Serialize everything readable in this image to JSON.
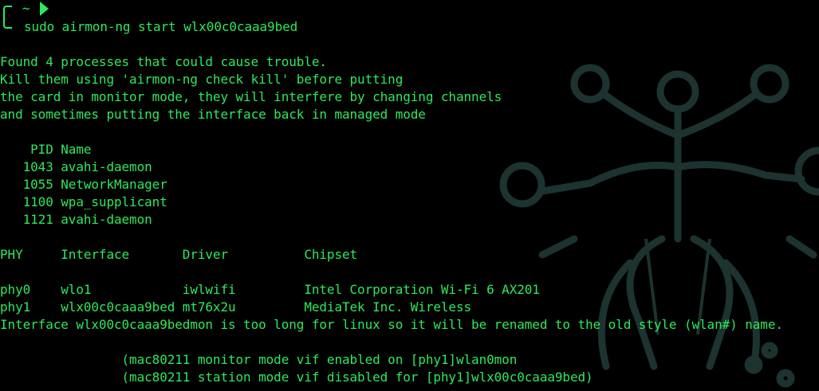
{
  "prompt": {
    "cwd": "~",
    "command": "sudo airmon-ng start wlx00c0caaa9bed"
  },
  "warning": [
    "Found 4 processes that could cause trouble.",
    "Kill them using 'airmon-ng check kill' before putting",
    "the card in monitor mode, they will interfere by changing channels",
    "and sometimes putting the interface back in managed mode"
  ],
  "processes": {
    "header": "    PID Name",
    "rows": [
      "   1043 avahi-daemon",
      "   1055 NetworkManager",
      "   1100 wpa_supplicant",
      "   1121 avahi-daemon"
    ]
  },
  "interfaces": {
    "header": "PHY     Interface       Driver          Chipset",
    "rows": [
      "phy0    wlo1            iwlwifi         Intel Corporation Wi-Fi 6 AX201",
      "phy1    wlx00c0caaa9bed mt76x2u         MediaTek Inc. Wireless"
    ]
  },
  "rename_notice": "Interface wlx00c0caaa9bedmon is too long for linux so it will be renamed to the old style (wlan#) name.",
  "status": [
    "                (mac80211 monitor mode vif enabled on [phy1]wlan0mon",
    "                (mac80211 station mode vif disabled for [phy1]wlx00c0caaa9bed)"
  ],
  "colors": {
    "background": "#000000",
    "text": "#2ee85a",
    "watermark": "#1c3330"
  },
  "icons": {
    "prompt": "prompt-bracket-icon",
    "arrow": "prompt-arrow-icon",
    "watermark": "circuit-logo-watermark"
  }
}
